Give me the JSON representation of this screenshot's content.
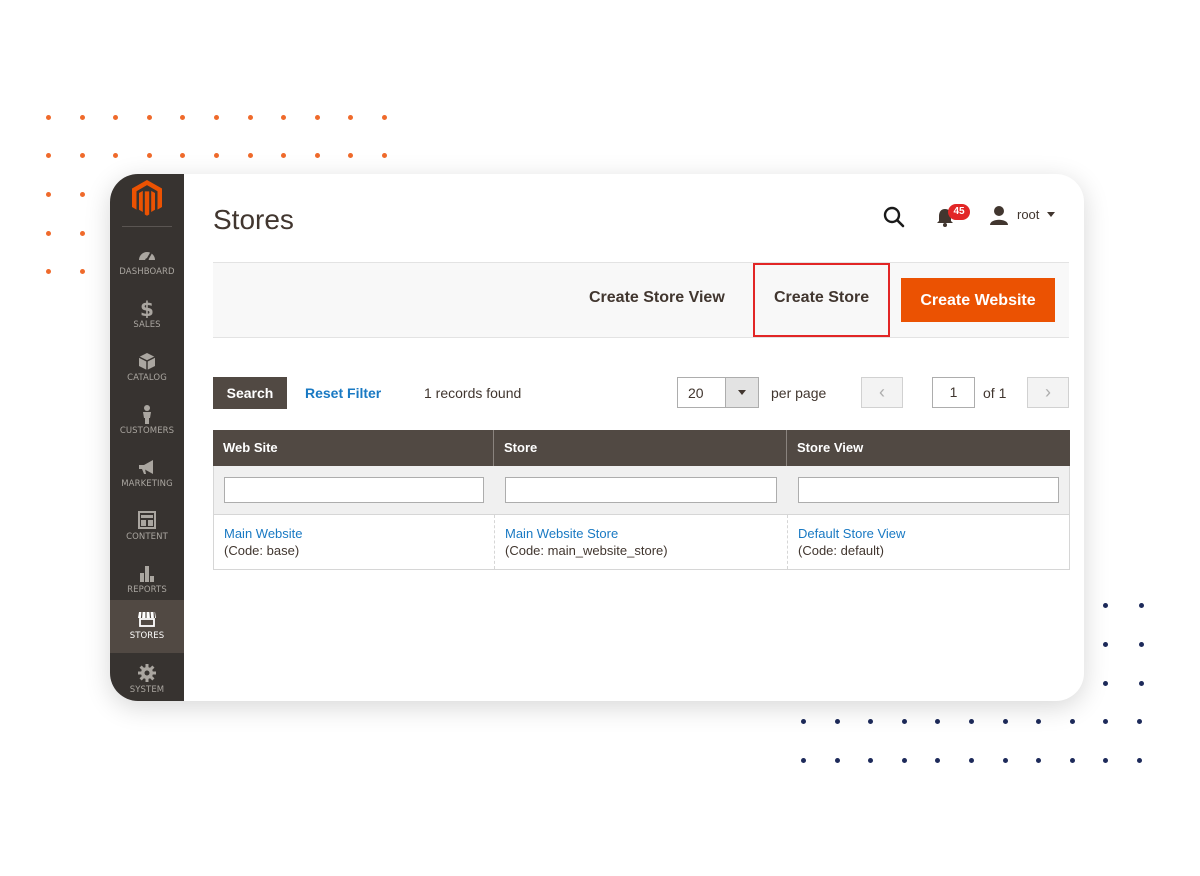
{
  "colors": {
    "accent": "#eb5202",
    "sidebar": "#373330",
    "sidebar_active": "#514943",
    "link": "#1979c3",
    "highlight": "#e22626"
  },
  "sidebar": {
    "items": [
      {
        "label": "DASHBOARD",
        "icon": "dashboard-icon"
      },
      {
        "label": "SALES",
        "icon": "dollar-icon"
      },
      {
        "label": "CATALOG",
        "icon": "box-icon"
      },
      {
        "label": "CUSTOMERS",
        "icon": "person-icon"
      },
      {
        "label": "MARKETING",
        "icon": "megaphone-icon"
      },
      {
        "label": "CONTENT",
        "icon": "layout-icon"
      },
      {
        "label": "REPORTS",
        "icon": "bar-chart-icon"
      },
      {
        "label": "STORES",
        "icon": "storefront-icon",
        "active": true
      },
      {
        "label": "SYSTEM",
        "icon": "gear-icon"
      }
    ]
  },
  "header": {
    "title": "Stores",
    "notifications_count": "45",
    "user": "root"
  },
  "actions": {
    "create_store_view": "Create Store View",
    "create_store": "Create Store",
    "create_website": "Create Website"
  },
  "toolbar": {
    "search": "Search",
    "reset_filter": "Reset Filter",
    "records_found": "1 records found",
    "per_page_value": "20",
    "per_page_label": "per page",
    "page": "1",
    "of_pages": "of 1"
  },
  "grid": {
    "columns": [
      "Web Site",
      "Store",
      "Store View"
    ],
    "rows": [
      {
        "website": "Main Website",
        "website_code": "(Code: base)",
        "store": "Main Website Store",
        "store_code": "(Code: main_website_store)",
        "store_view": "Default Store View",
        "store_view_code": "(Code: default)"
      }
    ]
  }
}
